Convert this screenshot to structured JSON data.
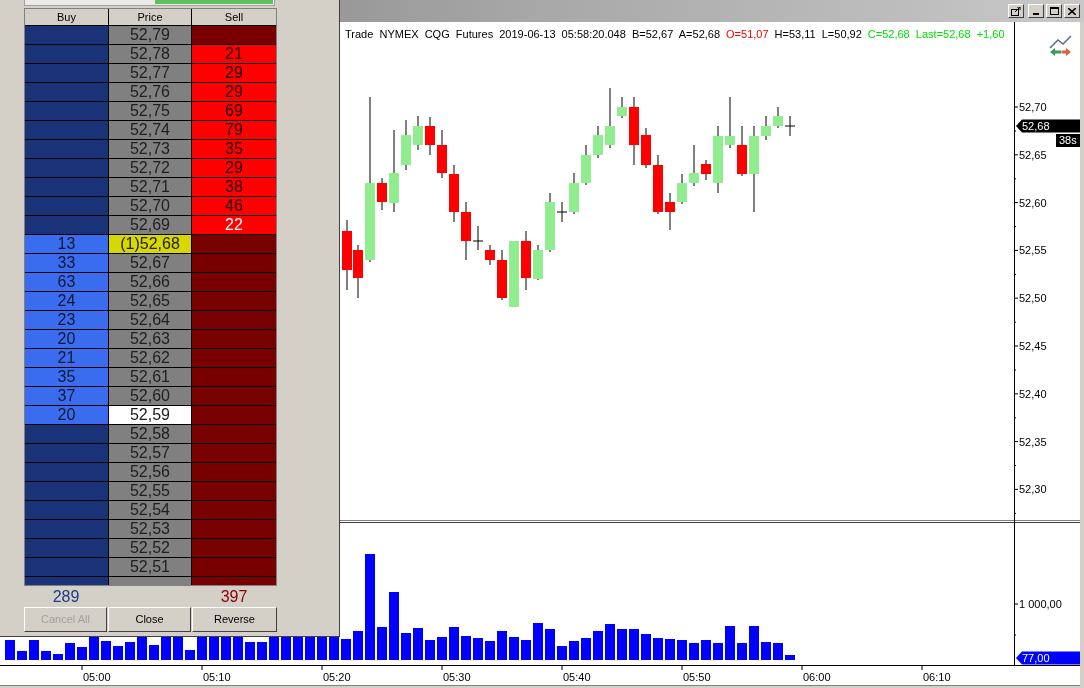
{
  "chart": {
    "header": [
      {
        "text": "Trade  NYMEX  CQG  Futures  2019-06-13  05:58:20.048  B=52,67  A=52,68",
        "color": "#000000"
      },
      {
        "text": "O=51,07",
        "color": "#ff0000"
      },
      {
        "text": "H=53,11  L=50,92",
        "color": "#000000"
      },
      {
        "text": "C=52,68  Last=52,68  +1,60",
        "color": "#00e000"
      }
    ],
    "price_ticks": [
      "52,70",
      "52,65",
      "52,60",
      "52,55",
      "52,50",
      "52,45",
      "52,40",
      "52,35",
      "52,30"
    ],
    "last_price": "52,68",
    "timer": "38s",
    "volume_tick": "1 000,00",
    "last_volume": "77,00",
    "time_labels": [
      "05:00",
      "05:10",
      "05:20",
      "05:30",
      "05:40",
      "05:50",
      "06:00",
      "06:10"
    ]
  },
  "dom": {
    "columns": [
      "Buy",
      "Price",
      "Sell"
    ],
    "rows": [
      {
        "price": "52,79",
        "last": false,
        "selected": false
      },
      {
        "price": "52,78",
        "last": false,
        "selected": false,
        "best": false,
        "sell": "21"
      },
      {
        "price": "52,77",
        "last": false,
        "selected": false,
        "best": false,
        "sell": "29"
      },
      {
        "price": "52,76",
        "last": false,
        "selected": false,
        "best": false,
        "sell": "29"
      },
      {
        "price": "52,75",
        "last": false,
        "selected": false,
        "best": false,
        "sell": "69"
      },
      {
        "price": "52,74",
        "last": false,
        "selected": false,
        "best": false,
        "sell": "79"
      },
      {
        "price": "52,73",
        "last": false,
        "selected": false,
        "best": false,
        "sell": "35"
      },
      {
        "price": "52,72",
        "last": false,
        "selected": false,
        "best": false,
        "sell": "29"
      },
      {
        "price": "52,71",
        "last": false,
        "selected": false,
        "best": false,
        "sell": "38"
      },
      {
        "price": "52,70",
        "last": false,
        "selected": false,
        "best": false,
        "sell": "46"
      },
      {
        "price": "52,69",
        "last": false,
        "selected": false,
        "best": true,
        "sell": "22"
      },
      {
        "price": "(1)52,68",
        "last": true,
        "selected": false,
        "buy": "13"
      },
      {
        "price": "52,67",
        "last": false,
        "selected": false,
        "buy": "33"
      },
      {
        "price": "52,66",
        "last": false,
        "selected": false,
        "buy": "63"
      },
      {
        "price": "52,65",
        "last": false,
        "selected": false,
        "buy": "24"
      },
      {
        "price": "52,64",
        "last": false,
        "selected": false,
        "buy": "23"
      },
      {
        "price": "52,63",
        "last": false,
        "selected": false,
        "buy": "20"
      },
      {
        "price": "52,62",
        "last": false,
        "selected": false,
        "buy": "21"
      },
      {
        "price": "52,61",
        "last": false,
        "selected": false,
        "buy": "35"
      },
      {
        "price": "52,60",
        "last": false,
        "selected": false,
        "buy": "37"
      },
      {
        "price": "52,59",
        "last": false,
        "selected": true,
        "buy": "20"
      },
      {
        "price": "52,58",
        "last": false,
        "selected": false
      },
      {
        "price": "52,57",
        "last": false,
        "selected": false
      },
      {
        "price": "52,56",
        "last": false,
        "selected": false
      },
      {
        "price": "52,55",
        "last": false,
        "selected": false
      },
      {
        "price": "52,54",
        "last": false,
        "selected": false
      },
      {
        "price": "52,53",
        "last": false,
        "selected": false
      },
      {
        "price": "52,52",
        "last": false,
        "selected": false
      },
      {
        "price": "52,51",
        "last": false,
        "selected": false
      }
    ],
    "totals": {
      "buy": "289",
      "sell": "397"
    },
    "buttons": [
      {
        "label": "Cancel All",
        "disabled": true
      },
      {
        "label": "Close",
        "disabled": false
      },
      {
        "label": "Reverse",
        "disabled": false
      }
    ]
  }
}
